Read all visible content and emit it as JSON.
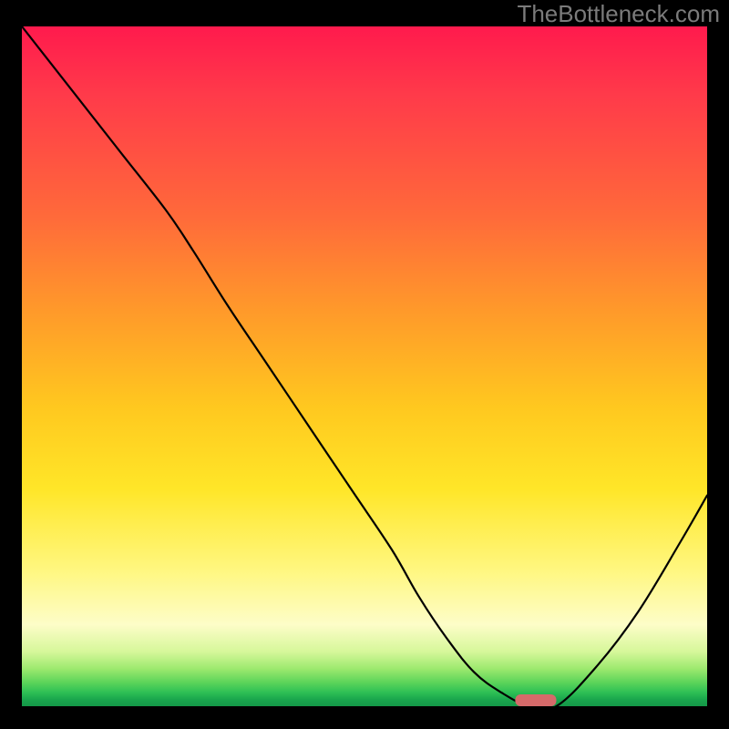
{
  "brand": {
    "watermark": "TheBottleneck.com"
  },
  "chart_data": {
    "type": "line",
    "title": "",
    "xlabel": "",
    "ylabel": "",
    "xlim": [
      0,
      100
    ],
    "ylim": [
      0,
      100
    ],
    "grid": false,
    "series": [
      {
        "name": "bottleneck-curve",
        "x": [
          0,
          7,
          14,
          21,
          25,
          30,
          36,
          42,
          48,
          54,
          58,
          62,
          66,
          70,
          74,
          78,
          84,
          90,
          96,
          100
        ],
        "values": [
          100,
          91,
          82,
          73,
          67,
          59,
          50,
          41,
          32,
          23,
          16,
          10,
          5,
          2,
          0,
          0,
          6,
          14,
          24,
          31
        ]
      }
    ],
    "marker": {
      "name": "optimal-zone",
      "x_range": [
        72,
        78
      ],
      "y": 0,
      "color": "#d56a6a"
    },
    "background_gradient": {
      "stops": [
        {
          "pos": 0.0,
          "color": "#ff1a4d"
        },
        {
          "pos": 0.28,
          "color": "#ff6a3a"
        },
        {
          "pos": 0.56,
          "color": "#ffc81f"
        },
        {
          "pos": 0.8,
          "color": "#fff780"
        },
        {
          "pos": 0.92,
          "color": "#d6f79a"
        },
        {
          "pos": 1.0,
          "color": "#149848"
        }
      ]
    }
  }
}
